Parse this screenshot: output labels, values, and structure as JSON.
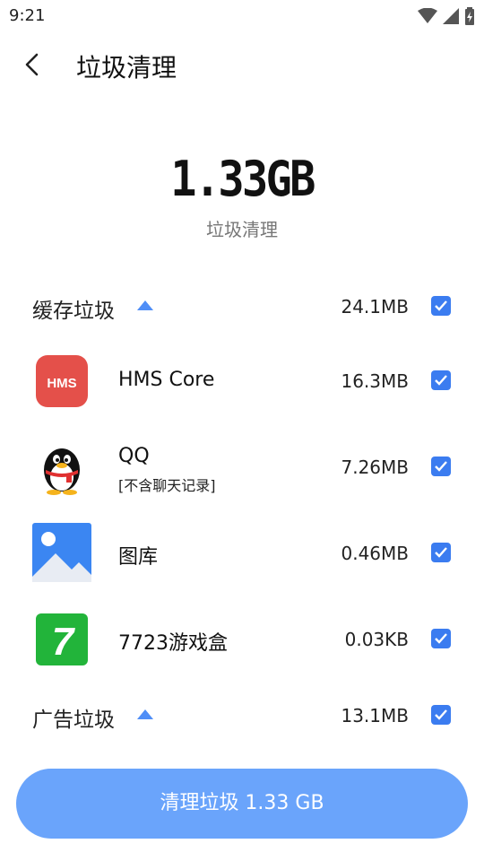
{
  "status": {
    "time": "9:21"
  },
  "header": {
    "title": "垃圾清理"
  },
  "summary": {
    "total": "1.33GB",
    "label": "垃圾清理"
  },
  "groups": [
    {
      "title": "缓存垃圾",
      "size": "24.1MB",
      "checked": true
    },
    {
      "title": "广告垃圾",
      "size": "13.1MB",
      "checked": true
    }
  ],
  "apps": [
    {
      "name": "HMS Core",
      "sub": "",
      "size": "16.3MB",
      "icon": "hms-core-icon",
      "icon_text": "HMS"
    },
    {
      "name": "QQ",
      "sub": "[不含聊天记录]",
      "size": "7.26MB",
      "icon": "qq-penguin-icon"
    },
    {
      "name": "图库",
      "sub": "",
      "size": "0.46MB",
      "icon": "gallery-icon"
    },
    {
      "name": "7723游戏盒",
      "sub": "",
      "size": "0.03KB",
      "icon": "game-box-icon",
      "icon_text": "7"
    }
  ],
  "action": {
    "label": "清理垃圾 1.33 GB"
  },
  "colors": {
    "accent": "#3b7cf0",
    "button": "#6aa4fb",
    "hms": "#e4504a",
    "game": "#22b43a"
  }
}
